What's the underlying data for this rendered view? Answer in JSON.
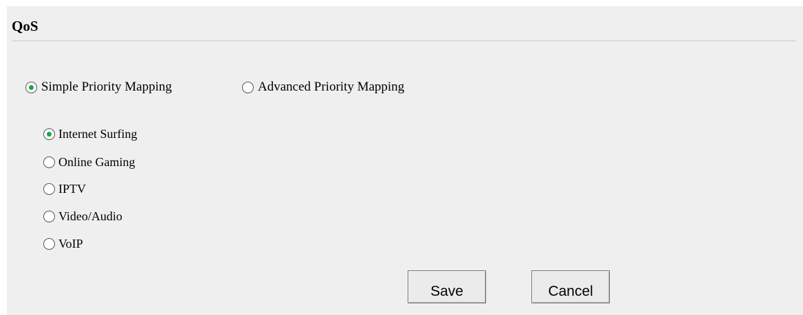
{
  "header": {
    "title": "QoS"
  },
  "mode": {
    "simple_label": "Simple Priority Mapping",
    "advanced_label": "Advanced Priority Mapping",
    "selected": "simple"
  },
  "applications": {
    "options": [
      {
        "label": "Internet Surfing",
        "checked": true
      },
      {
        "label": "Online Gaming",
        "checked": false
      },
      {
        "label": "IPTV",
        "checked": false
      },
      {
        "label": "Video/Audio",
        "checked": false
      },
      {
        "label": "VoIP",
        "checked": false
      }
    ]
  },
  "actions": {
    "save_label": "Save",
    "cancel_label": "Cancel"
  },
  "colors": {
    "panel_background": "#efefef",
    "radio_selected_dot": "#1fa14a"
  }
}
